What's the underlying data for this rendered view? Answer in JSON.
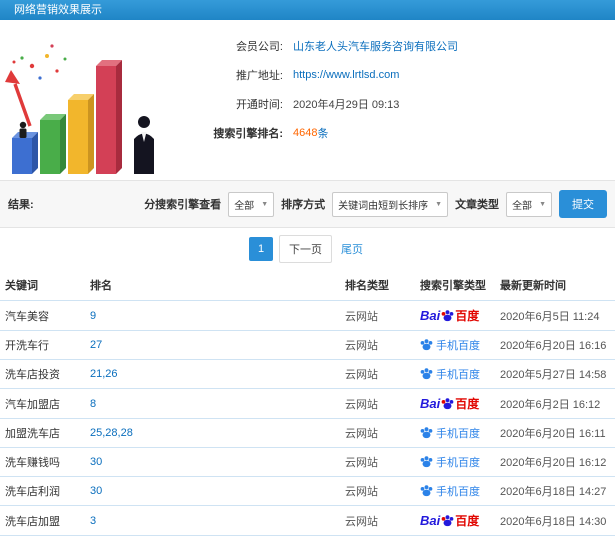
{
  "header": {
    "title": "网络营销效果展示"
  },
  "icons": {
    "chevron": "▼"
  },
  "info": {
    "rows": [
      {
        "label": "会员公司:",
        "value": "山东老人头汽车服务咨询有限公司"
      },
      {
        "label": "推广地址:",
        "value": "https://www.lrtlsd.com"
      },
      {
        "label": "开通时间:",
        "value": "2020年4月29日 09:13"
      },
      {
        "label": "搜索引擎排名:",
        "value": "4648",
        "suffix": "条"
      }
    ]
  },
  "filters": {
    "result_label": "结果:",
    "engine_label": "分搜索引擎查看",
    "engine_value": "全部",
    "sort_label": "排序方式",
    "sort_value": "关键词由短到长排序",
    "type_label": "文章类型",
    "type_value": "全部",
    "submit_label": "提交"
  },
  "pagination": {
    "current": "1",
    "next": "下一页",
    "last": "尾页"
  },
  "table": {
    "headers": [
      "关键词",
      "排名",
      "排名类型",
      "搜索引擎类型",
      "最新更新时间"
    ],
    "engine_labels": {
      "baidu_prefix": "Bai",
      "baidu_suffix": "百度",
      "mobile": "手机百度"
    },
    "rows": [
      {
        "keyword": "汽车美容",
        "rank": "9",
        "rank_type": "云网站",
        "engine": "baidu",
        "time": "2020年6月5日 11:24"
      },
      {
        "keyword": "开洗车行",
        "rank": "27",
        "rank_type": "云网站",
        "engine": "mobile-baidu",
        "time": "2020年6月20日 16:16"
      },
      {
        "keyword": "洗车店投资",
        "rank": "21,26",
        "rank_type": "云网站",
        "engine": "mobile-baidu",
        "time": "2020年5月27日 14:58"
      },
      {
        "keyword": "汽车加盟店",
        "rank": "8",
        "rank_type": "云网站",
        "engine": "baidu",
        "time": "2020年6月2日 16:12"
      },
      {
        "keyword": "加盟洗车店",
        "rank": "25,28,28",
        "rank_type": "云网站",
        "engine": "mobile-baidu",
        "time": "2020年6月20日 16:11"
      },
      {
        "keyword": "洗车赚钱吗",
        "rank": "30",
        "rank_type": "云网站",
        "engine": "mobile-baidu",
        "time": "2020年6月20日 16:12"
      },
      {
        "keyword": "洗车店利润",
        "rank": "30",
        "rank_type": "云网站",
        "engine": "mobile-baidu",
        "time": "2020年6月18日 14:27"
      },
      {
        "keyword": "洗车店加盟",
        "rank": "3",
        "rank_type": "云网站",
        "engine": "baidu",
        "time": "2020年6月18日 14:30"
      }
    ]
  }
}
